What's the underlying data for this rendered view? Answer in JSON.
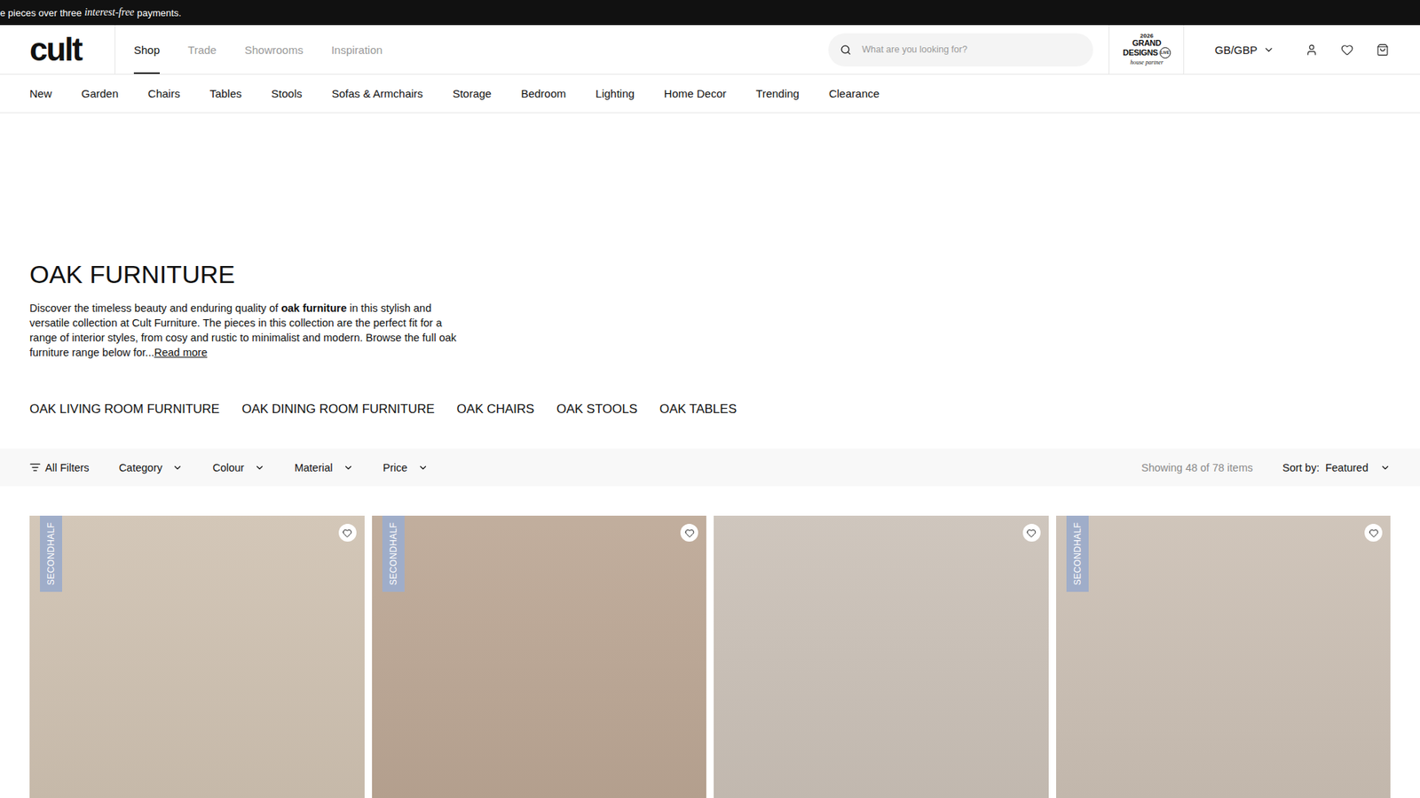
{
  "announcement": [
    {
      "text": "e pieces over three ",
      "italic": false
    },
    {
      "text": "interest-free",
      "italic": true
    },
    {
      "text": " payments.",
      "italic": false
    }
  ],
  "logo": "cult",
  "main_nav": [
    {
      "label": "Shop",
      "selected": true
    },
    {
      "label": "Trade",
      "selected": false
    },
    {
      "label": "Showrooms",
      "selected": false
    },
    {
      "label": "Inspiration",
      "selected": false
    }
  ],
  "search": {
    "placeholder": "What are you looking for?"
  },
  "partner_badge": {
    "year": "2026",
    "line1": "GRAND",
    "line2": "DESIGNS",
    "live": "LIVE",
    "tagline": "house partner"
  },
  "currency": "GB/GBP",
  "categories": [
    "New",
    "Garden",
    "Chairs",
    "Tables",
    "Stools",
    "Sofas & Armchairs",
    "Storage",
    "Bedroom",
    "Lighting",
    "Home Decor",
    "Trending",
    "Clearance"
  ],
  "page": {
    "title": "OAK FURNITURE",
    "description": [
      {
        "text": "Discover the timeless beauty and enduring quality of ",
        "bold": false
      },
      {
        "text": "oak furniture",
        "bold": true
      },
      {
        "text": " in this stylish and versatile collection at Cult Furniture. The pieces in this collection are the perfect fit for a range of interior styles, from cosy and rustic to minimalist and modern. Browse the full oak furniture range below for...",
        "bold": false
      }
    ],
    "read_more": "Read more"
  },
  "subcategories": [
    "OAK LIVING ROOM FURNITURE",
    "OAK DINING ROOM FURNITURE",
    "OAK CHAIRS",
    "OAK STOOLS",
    "OAK TABLES"
  ],
  "filters": {
    "all": "All Filters",
    "dropdowns": [
      "Category",
      "Colour",
      "Material",
      "Price"
    ],
    "count": "Showing 48 of 78 items",
    "sort_label": "Sort by:",
    "sort_value": "Featured"
  },
  "products": [
    {
      "badge": "SECONDHALF",
      "favorite": false,
      "color": "#cdbfae"
    },
    {
      "badge": "SECONDHALF",
      "favorite": false,
      "color": "#b9a390"
    },
    {
      "badge": null,
      "favorite": false,
      "color": "#c8beb4"
    },
    {
      "badge": "SECONDHALF",
      "favorite": false,
      "color": "#c9bdb1"
    }
  ]
}
